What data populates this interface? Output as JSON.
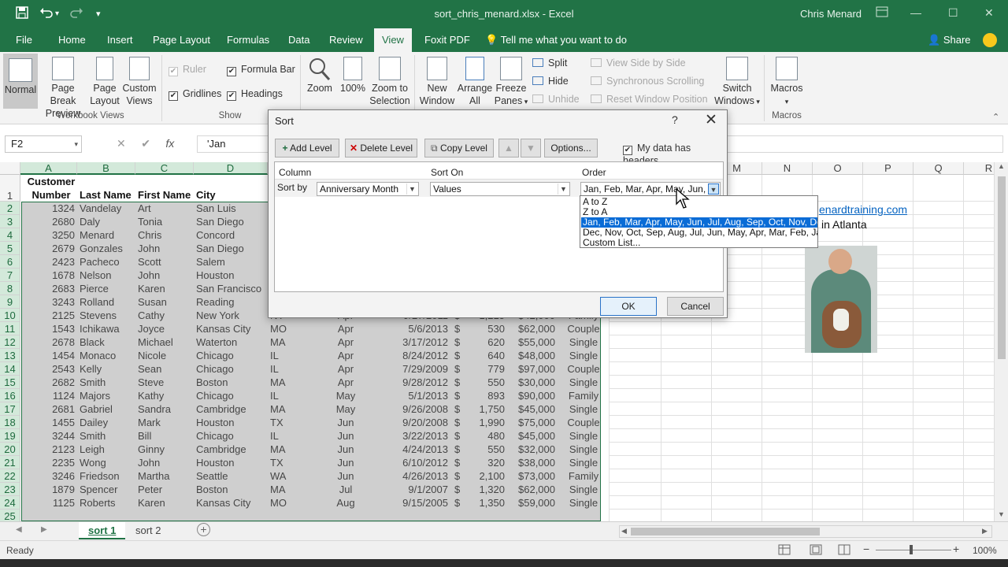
{
  "app": {
    "title": "sort_chris_menard.xlsx  -  Excel",
    "user": "Chris Menard",
    "colors": {
      "brand": "#217346",
      "selection": "#0a6cd6"
    }
  },
  "quick_access": {
    "icons": [
      "save-icon",
      "undo-icon",
      "redo-icon",
      "customize-icon"
    ]
  },
  "tabs": [
    "File",
    "Home",
    "Insert",
    "Page Layout",
    "Formulas",
    "Data",
    "Review",
    "View",
    "Foxit PDF"
  ],
  "active_tab": "View",
  "tell_me": "Tell me what you want to do",
  "share": "Share",
  "ribbon": {
    "workbook_views": {
      "group": "Workbook Views",
      "normal": "Normal",
      "page_break_1": "Page Break",
      "page_break_2": "Preview",
      "page_layout_1": "Page",
      "page_layout_2": "Layout",
      "custom_1": "Custom",
      "custom_2": "Views"
    },
    "show": {
      "group": "Show",
      "ruler": "Ruler",
      "formula_bar": "Formula Bar",
      "gridlines": "Gridlines",
      "headings": "Headings"
    },
    "zoom": {
      "group": "Zoom",
      "zoom": "Zoom",
      "hundred": "100%",
      "zoom_sel_1": "Zoom to",
      "zoom_sel_2": "Selection"
    },
    "window": {
      "group": "Window",
      "new_window_1": "New",
      "new_window_2": "Window",
      "arrange_1": "Arrange",
      "arrange_2": "All",
      "freeze_1": "Freeze",
      "freeze_2": "Panes",
      "split": "Split",
      "hide": "Hide",
      "unhide": "Unhide",
      "side_by_side": "View Side by Side",
      "sync_scroll": "Synchronous Scrolling",
      "reset_pos": "Reset Window Position",
      "switch_1": "Switch",
      "switch_2": "Windows"
    },
    "macros": {
      "group": "Macros",
      "label": "Macros"
    }
  },
  "formula_bar": {
    "name_box": "F2",
    "content": "'Jan"
  },
  "columns": [
    "A",
    "B",
    "C",
    "D",
    "E",
    "F",
    "G",
    "H",
    "I",
    "J",
    "K",
    "L",
    "M",
    "N",
    "O",
    "P",
    "Q",
    "R"
  ],
  "rows": [
    "1",
    "2",
    "3",
    "4",
    "5",
    "6",
    "7",
    "8",
    "9",
    "10",
    "11",
    "12",
    "13",
    "14",
    "15",
    "16",
    "17",
    "18",
    "19",
    "20",
    "21",
    "22",
    "23",
    "24",
    "25"
  ],
  "headers": {
    "a1": "Customer",
    "a2": "Number",
    "b": "Last Name",
    "c": "First Name",
    "d": "City"
  },
  "data_rows": [
    [
      "1324",
      "Vandelay",
      "Art",
      "San Luis",
      "",
      "",
      "",
      "",
      "",
      ""
    ],
    [
      "2680",
      "Daly",
      "Tonia",
      "San Diego",
      "",
      "",
      "",
      "",
      "",
      ""
    ],
    [
      "3250",
      "Menard",
      "Chris",
      "Concord",
      "",
      "",
      "",
      "",
      "",
      ""
    ],
    [
      "2679",
      "Gonzales",
      "John",
      "San Diego",
      "",
      "",
      "",
      "",
      "",
      ""
    ],
    [
      "2423",
      "Pacheco",
      "Scott",
      "Salem",
      "",
      "",
      "",
      "",
      "",
      ""
    ],
    [
      "1678",
      "Nelson",
      "John",
      "Houston",
      "",
      "",
      "",
      "",
      "",
      ""
    ],
    [
      "2683",
      "Pierce",
      "Karen",
      "San Francisco",
      "",
      "",
      "",
      "",
      "",
      ""
    ],
    [
      "3243",
      "Rolland",
      "Susan",
      "Reading",
      "",
      "",
      "",
      "",
      "",
      ""
    ],
    [
      "2125",
      "Stevens",
      "Cathy",
      "New York",
      "NY",
      "Apr",
      "9/27/2011",
      "1,215",
      "$42,000",
      "Family"
    ],
    [
      "1543",
      "Ichikawa",
      "Joyce",
      "Kansas City",
      "MO",
      "Apr",
      "5/6/2013",
      "530",
      "$62,000",
      "Couple"
    ],
    [
      "2678",
      "Black",
      "Michael",
      "Waterton",
      "MA",
      "Apr",
      "3/17/2012",
      "620",
      "$55,000",
      "Single"
    ],
    [
      "1454",
      "Monaco",
      "Nicole",
      "Chicago",
      "IL",
      "Apr",
      "8/24/2012",
      "640",
      "$48,000",
      "Single"
    ],
    [
      "2543",
      "Kelly",
      "Sean",
      "Chicago",
      "IL",
      "Apr",
      "7/29/2009",
      "779",
      "$97,000",
      "Couple"
    ],
    [
      "2682",
      "Smith",
      "Steve",
      "Boston",
      "MA",
      "Apr",
      "9/28/2012",
      "550",
      "$30,000",
      "Single"
    ],
    [
      "1124",
      "Majors",
      "Kathy",
      "Chicago",
      "IL",
      "May",
      "5/1/2013",
      "893",
      "$90,000",
      "Family"
    ],
    [
      "2681",
      "Gabriel",
      "Sandra",
      "Cambridge",
      "MA",
      "May",
      "9/26/2008",
      "1,750",
      "$45,000",
      "Single"
    ],
    [
      "1455",
      "Dailey",
      "Mark",
      "Houston",
      "TX",
      "Jun",
      "9/20/2008",
      "1,990",
      "$75,000",
      "Couple"
    ],
    [
      "3244",
      "Smith",
      "Bill",
      "Chicago",
      "IL",
      "Jun",
      "3/22/2013",
      "480",
      "$45,000",
      "Single"
    ],
    [
      "2123",
      "Leigh",
      "Ginny",
      "Cambridge",
      "MA",
      "Jun",
      "4/24/2013",
      "550",
      "$32,000",
      "Single"
    ],
    [
      "2235",
      "Wong",
      "John",
      "Houston",
      "TX",
      "Jun",
      "6/10/2012",
      "320",
      "$38,000",
      "Single"
    ],
    [
      "3246",
      "Friedson",
      "Martha",
      "Seattle",
      "WA",
      "Jun",
      "4/26/2013",
      "2,100",
      "$73,000",
      "Family"
    ],
    [
      "1879",
      "Spencer",
      "Peter",
      "Boston",
      "MA",
      "Jul",
      "9/1/2007",
      "1,320",
      "$62,000",
      "Single"
    ],
    [
      "1125",
      "Roberts",
      "Karen",
      "Kansas City",
      "MO",
      "Aug",
      "9/15/2005",
      "1,350",
      "$59,000",
      "Single"
    ]
  ],
  "currency_symbol": "$",
  "side_info": {
    "link": "enardtraining.com",
    "location": "in Atlanta"
  },
  "sheets": [
    "sort 1",
    "sort 2"
  ],
  "active_sheet": "sort 1",
  "status": {
    "ready": "Ready",
    "zoom": "100%"
  },
  "dialog": {
    "title": "Sort",
    "help": "?",
    "close": "✕",
    "add_level": "Add Level",
    "delete_level": "Delete Level",
    "copy_level": "Copy Level",
    "options": "Options...",
    "my_data_headers": "My data has headers",
    "col_column": "Column",
    "col_sort_on": "Sort On",
    "col_order": "Order",
    "sort_by": "Sort by",
    "column_value": "Anniversary Month",
    "sort_on_value": "Values",
    "order_value": "Jan, Feb, Mar, Apr, May, Jun, Ju",
    "order_options": [
      "A to Z",
      "Z to A",
      "Jan, Feb, Mar, Apr, May, Jun, Jul, Aug, Sep, Oct, Nov, Dec",
      "Dec, Nov, Oct, Sep, Aug, Jul, Jun, May, Apr, Mar, Feb, Jan",
      "Custom List..."
    ],
    "highlighted_option": 2,
    "ok": "OK",
    "cancel": "Cancel"
  }
}
